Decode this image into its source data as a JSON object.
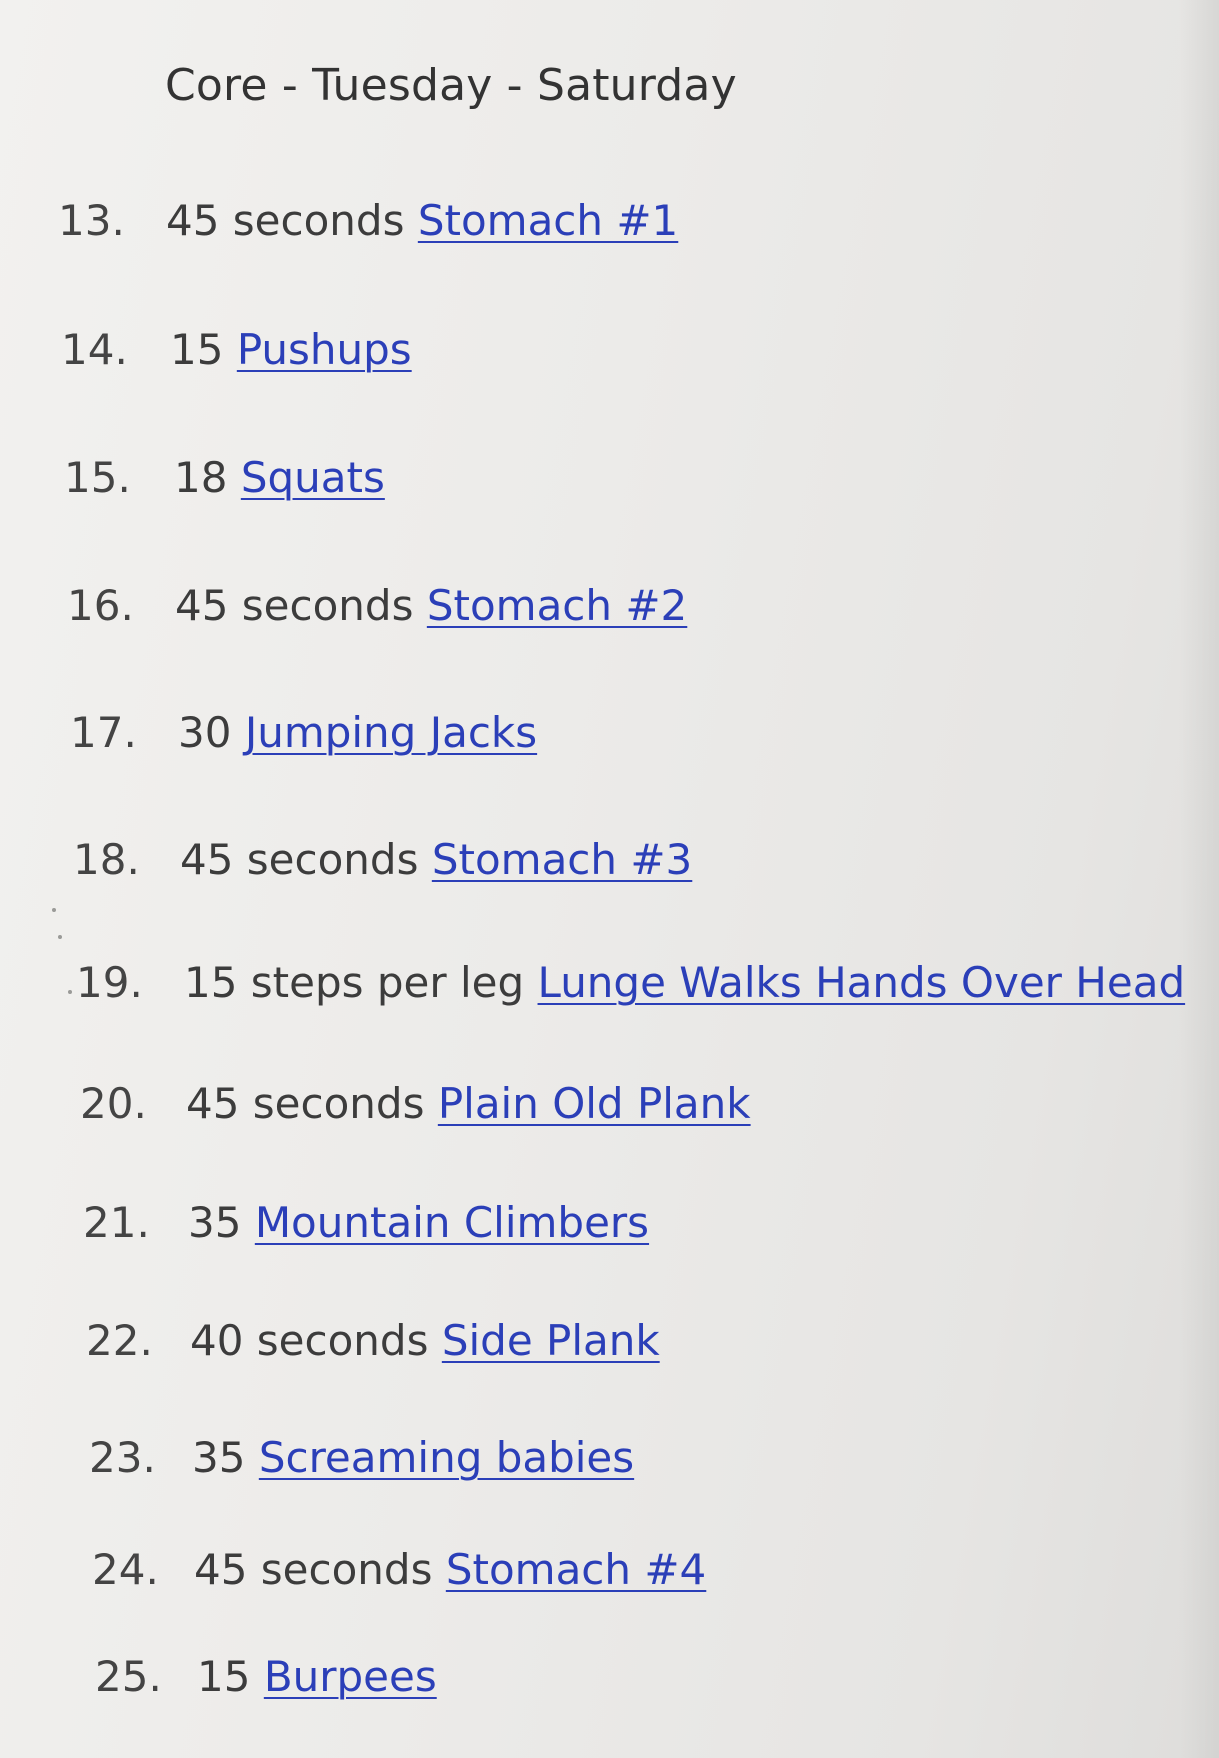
{
  "page": {
    "title": "Core - Tuesday - Saturday"
  },
  "items": [
    {
      "number": "13.",
      "amount": "45 seconds",
      "link_text": "Stomach #1"
    },
    {
      "number": "14.",
      "amount": "15",
      "link_text": "Pushups"
    },
    {
      "number": "15.",
      "amount": "18",
      "link_text": "Squats"
    },
    {
      "number": "16.",
      "amount": "45 seconds",
      "link_text": "Stomach #2"
    },
    {
      "number": "17.",
      "amount": "30",
      "link_text": "Jumping Jacks"
    },
    {
      "number": "18.",
      "amount": "45 seconds",
      "link_text": "Stomach #3"
    },
    {
      "number": "19.",
      "amount": "15 steps per leg",
      "link_text": "Lunge Walks Hands Over Head"
    },
    {
      "number": "20.",
      "amount": "45 seconds",
      "link_text": "Plain Old Plank"
    },
    {
      "number": "21.",
      "amount": "35",
      "link_text": "Mountain Climbers"
    },
    {
      "number": "22.",
      "amount": "40 seconds",
      "link_text": "Side Plank"
    },
    {
      "number": "23.",
      "amount": "35",
      "link_text": "Screaming babies"
    },
    {
      "number": "24.",
      "amount": "45 seconds",
      "link_text": "Stomach #4"
    },
    {
      "number": "25.",
      "amount": "15",
      "link_text": "Burpees"
    }
  ],
  "colors": {
    "link": "#2b3fb8",
    "text": "#3c3c3c",
    "background": "#eceae8"
  }
}
